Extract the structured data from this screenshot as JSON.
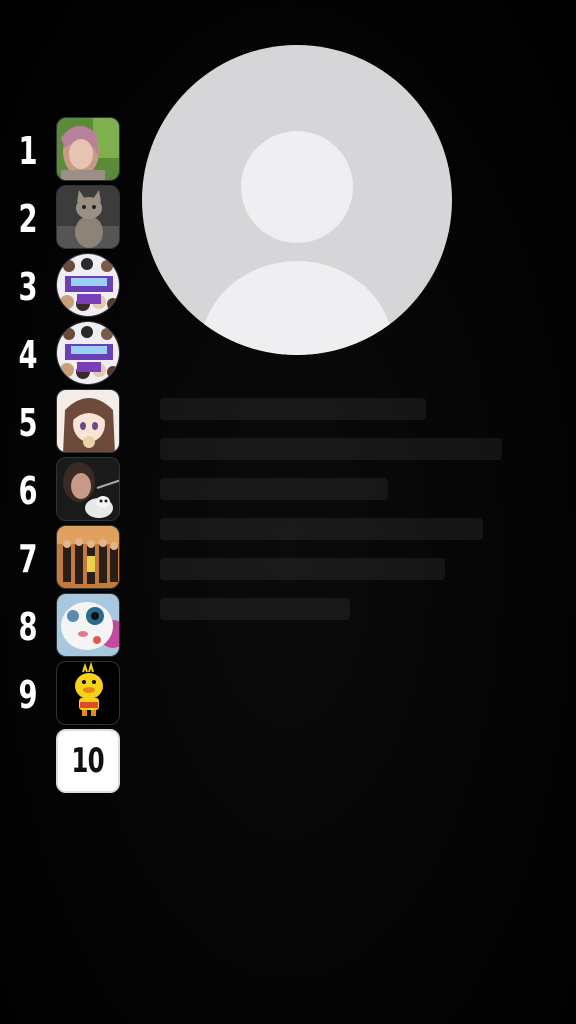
{
  "profile": {
    "avatar_icon": "default-user-avatar-icon",
    "avatar_color": "#d6d6d9"
  },
  "ranking": {
    "items": [
      {
        "rank": "1",
        "thumb": "girl-selfie-photo"
      },
      {
        "rank": "2",
        "thumb": "kitten-photo"
      },
      {
        "rank": "3",
        "thumb": "group-collage-photo"
      },
      {
        "rank": "4",
        "thumb": "group-collage-photo"
      },
      {
        "rank": "5",
        "thumb": "anime-girl-image"
      },
      {
        "rank": "6",
        "thumb": "girl-with-cat-photo"
      },
      {
        "rank": "7",
        "thumb": "group-standing-photo"
      },
      {
        "rank": "8",
        "thumb": "cartoon-doll-image"
      },
      {
        "rank": "9",
        "thumb": "yellow-duck-sticker"
      },
      {
        "rank": "10",
        "thumb": "number-tile"
      }
    ],
    "tile_10_label": "10"
  }
}
